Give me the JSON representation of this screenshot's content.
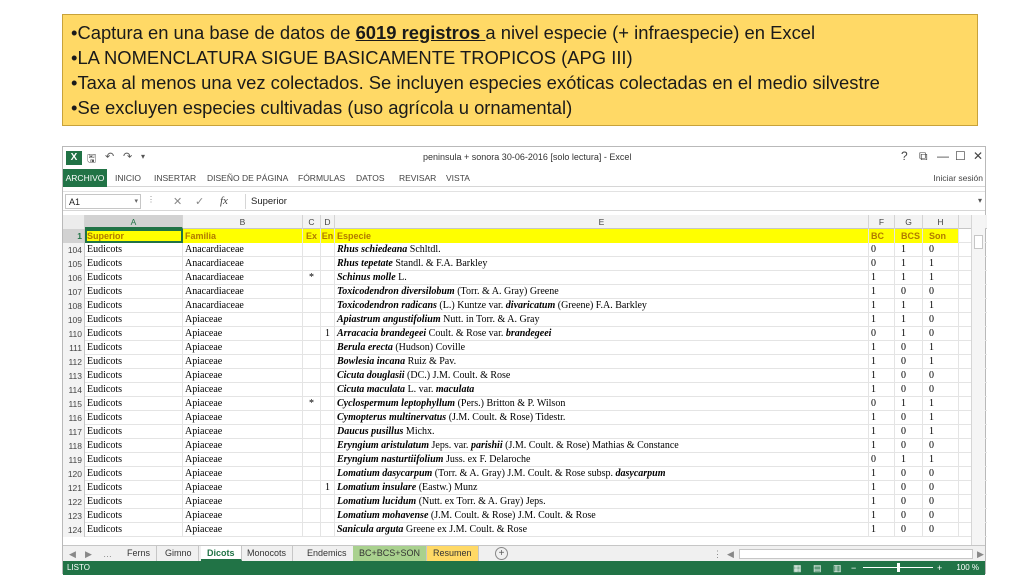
{
  "callout": {
    "line1_pre": "•Captura en una base de datos de ",
    "line1_u": "6019 registros ",
    "line1_post": "a nivel especie (+ infraespecie) en Excel",
    "line2": "•LA NOMENCLATURA SIGUE BASICAMENTE TROPICOS (APG III)",
    "line3": "•Taxa al menos una vez colectados.  Se incluyen especies exóticas colectadas en el medio silvestre",
    "line4": "•Se excluyen especies cultivadas (uso agrícola u ornamental)"
  },
  "window": {
    "title": "peninsula + sonora 30-06-2016  [solo lectura] - Excel",
    "controls": [
      "?",
      "⧉",
      "—",
      "☐",
      "✕"
    ]
  },
  "ribbon": {
    "tabs": [
      "ARCHIVO",
      "INICIO",
      "INSERTAR",
      "DISEÑO DE PÁGINA",
      "FÓRMULAS",
      "DATOS",
      "REVISAR",
      "VISTA"
    ],
    "signin": "Iniciar sesión"
  },
  "formula_bar": {
    "cell_ref": "A1",
    "content": "Superior"
  },
  "columns": [
    "A",
    "B",
    "C",
    "D",
    "E",
    "F",
    "G",
    "H"
  ],
  "header_row": {
    "num": "1",
    "cells": [
      "Superior",
      "Familia",
      "Ex",
      "En",
      "Especie",
      "BC",
      "BCS",
      "Son"
    ]
  },
  "rows": [
    {
      "n": "104",
      "a": "Eudicots",
      "b": "Anacardiaceae",
      "c": "",
      "d": "",
      "sp": "Rhus schiedeana",
      "au": " Schltdl.",
      "f": "0",
      "g": "1",
      "h": "0"
    },
    {
      "n": "105",
      "a": "Eudicots",
      "b": "Anacardiaceae",
      "c": "",
      "d": "",
      "sp": "Rhus tepetate",
      "au": " Standl. & F.A. Barkley",
      "f": "0",
      "g": "1",
      "h": "1"
    },
    {
      "n": "106",
      "a": "Eudicots",
      "b": "Anacardiaceae",
      "c": "*",
      "d": "",
      "sp": "Schinus molle",
      "au": " L.",
      "f": "1",
      "g": "1",
      "h": "1"
    },
    {
      "n": "107",
      "a": "Eudicots",
      "b": "Anacardiaceae",
      "c": "",
      "d": "",
      "sp": "Toxicodendron diversilobum",
      "au": " (Torr. & A. Gray) Greene",
      "f": "1",
      "g": "0",
      "h": "0"
    },
    {
      "n": "108",
      "a": "Eudicots",
      "b": "Anacardiaceae",
      "c": "",
      "d": "",
      "sp": "Toxicodendron radicans",
      "au": " (L.) Kuntze var. ",
      "sp2": "divaricatum",
      "au2": " (Greene) F.A. Barkley",
      "f": "1",
      "g": "1",
      "h": "1"
    },
    {
      "n": "109",
      "a": "Eudicots",
      "b": "Apiaceae",
      "c": "",
      "d": "",
      "sp": "Apiastrum angustifolium",
      "au": " Nutt. in Torr. & A. Gray",
      "f": "1",
      "g": "1",
      "h": "0"
    },
    {
      "n": "110",
      "a": "Eudicots",
      "b": "Apiaceae",
      "c": "",
      "d": "1",
      "sp": "Arracacia brandegeei",
      "au": " Coult. & Rose var. ",
      "sp2": "brandegeei",
      "au2": "",
      "f": "0",
      "g": "1",
      "h": "0"
    },
    {
      "n": "111",
      "a": "Eudicots",
      "b": "Apiaceae",
      "c": "",
      "d": "",
      "sp": "Berula erecta",
      "au": " (Hudson) Coville",
      "f": "1",
      "g": "0",
      "h": "1"
    },
    {
      "n": "112",
      "a": "Eudicots",
      "b": "Apiaceae",
      "c": "",
      "d": "",
      "sp": "Bowlesia incana",
      "au": " Ruiz & Pav.",
      "f": "1",
      "g": "0",
      "h": "1"
    },
    {
      "n": "113",
      "a": "Eudicots",
      "b": "Apiaceae",
      "c": "",
      "d": "",
      "sp": "Cicuta douglasii",
      "au": " (DC.) J.M. Coult. & Rose",
      "f": "1",
      "g": "0",
      "h": "0"
    },
    {
      "n": "114",
      "a": "Eudicots",
      "b": "Apiaceae",
      "c": "",
      "d": "",
      "sp": "Cicuta maculata",
      "au": " L. var. ",
      "sp2": "maculata",
      "au2": "",
      "f": "1",
      "g": "0",
      "h": "0"
    },
    {
      "n": "115",
      "a": "Eudicots",
      "b": "Apiaceae",
      "c": "*",
      "d": "",
      "sp": "Cyclospermum leptophyllum",
      "au": " (Pers.) Britton & P. Wilson",
      "f": "0",
      "g": "1",
      "h": "1"
    },
    {
      "n": "116",
      "a": "Eudicots",
      "b": "Apiaceae",
      "c": "",
      "d": "",
      "sp": "Cymopterus multinervatus",
      "au": " (J.M. Coult. & Rose) Tidestr.",
      "f": "1",
      "g": "0",
      "h": "1"
    },
    {
      "n": "117",
      "a": "Eudicots",
      "b": "Apiaceae",
      "c": "",
      "d": "",
      "sp": "Daucus pusillus",
      "au": " Michx.",
      "f": "1",
      "g": "0",
      "h": "1"
    },
    {
      "n": "118",
      "a": "Eudicots",
      "b": "Apiaceae",
      "c": "",
      "d": "",
      "sp": "Eryngium aristulatum",
      "au": " Jeps. var. ",
      "sp2": "parishii",
      "au2": " (J.M. Coult. & Rose) Mathias & Constance",
      "f": "1",
      "g": "0",
      "h": "0"
    },
    {
      "n": "119",
      "a": "Eudicots",
      "b": "Apiaceae",
      "c": "",
      "d": "",
      "sp": "Eryngium nasturtiifolium",
      "au": " Juss. ex F. Delaroche",
      "f": "0",
      "g": "1",
      "h": "1"
    },
    {
      "n": "120",
      "a": "Eudicots",
      "b": "Apiaceae",
      "c": "",
      "d": "",
      "sp": "Lomatium dasycarpum",
      "au": " (Torr. & A. Gray) J.M. Coult. & Rose subsp. ",
      "sp2": "dasycarpum",
      "au2": "",
      "f": "1",
      "g": "0",
      "h": "0"
    },
    {
      "n": "121",
      "a": "Eudicots",
      "b": "Apiaceae",
      "c": "",
      "d": "1",
      "sp": "Lomatium insulare",
      "au": " (Eastw.) Munz",
      "f": "1",
      "g": "0",
      "h": "0"
    },
    {
      "n": "122",
      "a": "Eudicots",
      "b": "Apiaceae",
      "c": "",
      "d": "",
      "sp": "Lomatium lucidum",
      "au": " (Nutt. ex Torr. & A. Gray) Jeps.",
      "f": "1",
      "g": "0",
      "h": "0"
    },
    {
      "n": "123",
      "a": "Eudicots",
      "b": "Apiaceae",
      "c": "",
      "d": "",
      "sp": "Lomatium mohavense",
      "au": " (J.M. Coult. & Rose) J.M. Coult. & Rose",
      "f": "1",
      "g": "0",
      "h": "0"
    },
    {
      "n": "124",
      "a": "Eudicots",
      "b": "Apiaceae",
      "c": "",
      "d": "",
      "sp": "Sanicula arguta",
      "au": " Greene ex J.M. Coult. & Rose",
      "f": "1",
      "g": "0",
      "h": "0"
    }
  ],
  "sheet_tabs": [
    "Ferns",
    "Gimno",
    "Dicots",
    "Monocots",
    "Endemics",
    "BC+BCS+SON",
    "Resumen"
  ],
  "active_sheet": "Dicots",
  "status": {
    "text": "LISTO",
    "zoom": "100 %"
  }
}
